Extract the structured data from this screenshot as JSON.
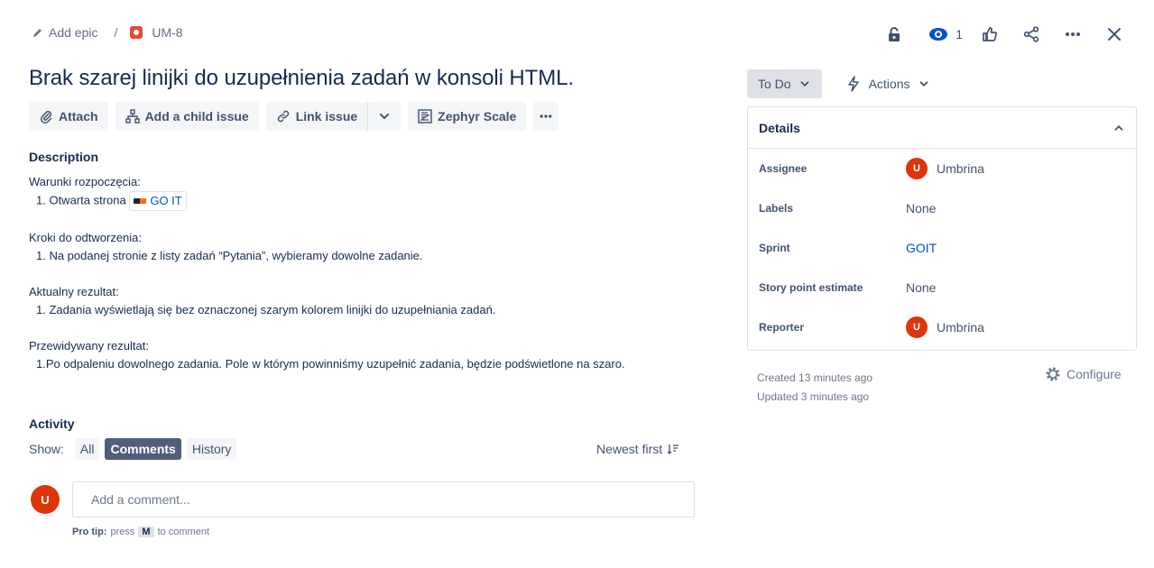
{
  "breadcrumb": {
    "epic": "Add epic",
    "separator": "/",
    "issue_key": "UM-8"
  },
  "header": {
    "watch_count": "1"
  },
  "issue": {
    "title": "Brak szarej linijki do uzupełnienia zadań w konsoli HTML."
  },
  "toolbar": {
    "attach": "Attach",
    "add_child": "Add a child issue",
    "link_issue": "Link issue",
    "zephyr": "Zephyr Scale"
  },
  "description": {
    "title": "Description",
    "sections": [
      {
        "heading": "Warunki rozpoczęcia:",
        "item_prefix": "1. Otwarta strona",
        "link_text": "GO IT"
      },
      {
        "heading": "Kroki do odtworzenia:",
        "item": "1. Na podanej stronie z listy zadań “Pytania”, wybieramy dowolne zadanie."
      },
      {
        "heading": "Aktualny rezultat:",
        "item": "1. Zadania wyświetlają się bez oznaczonej szarym kolorem linijki do uzupełniania zadań."
      },
      {
        "heading": "Przewidywany rezultat:",
        "item": "1.Po odpaleniu dowolnego zadania. Pole w którym powinniśmy uzupełnić zadania, będzie podświetlone na szaro."
      }
    ]
  },
  "activity": {
    "title": "Activity",
    "show_label": "Show:",
    "filters": [
      "All",
      "Comments",
      "History"
    ],
    "sort": "Newest first",
    "comment_placeholder": "Add a comment...",
    "avatar_letter": "U",
    "protip_label": "Pro tip:",
    "protip_press": "press",
    "protip_key": "M",
    "protip_rest": "to comment"
  },
  "status": {
    "current": "To Do",
    "actions": "Actions"
  },
  "details": {
    "title": "Details",
    "rows": [
      {
        "label": "Assignee",
        "value": "Umbrina",
        "avatar": "U"
      },
      {
        "label": "Labels",
        "value": "None"
      },
      {
        "label": "Sprint",
        "value": "GOIT"
      },
      {
        "label": "Story point estimate",
        "value": "None"
      },
      {
        "label": "Reporter",
        "value": "Umbrina",
        "avatar": "U"
      }
    ]
  },
  "meta": {
    "created": "Created 13 minutes ago",
    "updated": "Updated 3 minutes ago",
    "configure": "Configure"
  },
  "colors": {
    "accent": "#0052cc",
    "avatar": "#de350b",
    "issue_type": "#e5493a"
  }
}
